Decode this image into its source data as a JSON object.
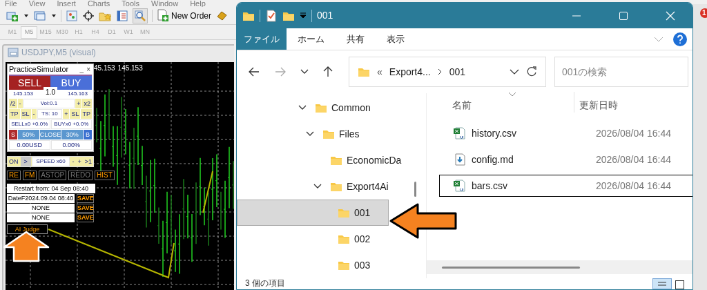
{
  "menu": [
    "File",
    "View",
    "Insert",
    "Charts",
    "Tools",
    "Window",
    "Help"
  ],
  "toolbar": {
    "new_order": "New Order"
  },
  "notification_badge": "1",
  "timeframes": [
    {
      "label": "M1",
      "selected": false
    },
    {
      "label": "M5",
      "selected": true
    },
    {
      "label": "M15",
      "selected": false
    },
    {
      "label": "M30",
      "selected": false
    },
    {
      "label": "H1",
      "selected": false
    },
    {
      "label": "H4",
      "selected": false
    },
    {
      "label": "D1",
      "selected": false
    },
    {
      "label": "W1",
      "selected": false
    },
    {
      "label": "MN",
      "selected": false
    }
  ],
  "chart_window": {
    "title": "USDJPY,M5 (visual)",
    "price_labels": [
      "45.153",
      "145.153"
    ]
  },
  "simulator": {
    "title": "PracticeSimulator",
    "minimize": "_",
    "close": "×",
    "sell": "SELL",
    "buy": "BUY",
    "bid": "145.153",
    "lot": "1.0",
    "ask": "145.163",
    "volume_row": [
      {
        "label": "/2",
        "kind": "key"
      },
      {
        "label": "-",
        "kind": "key"
      },
      {
        "label": "Vol:0.1",
        "kind": "value"
      },
      {
        "label": "+",
        "kind": "key"
      },
      {
        "label": "x2",
        "kind": "key"
      }
    ],
    "ts_row": [
      {
        "label": "TP",
        "kind": "key"
      },
      {
        "label": "SL",
        "kind": "key"
      },
      {
        "label": "-",
        "kind": "key"
      },
      {
        "label": "TS: 10",
        "kind": "value"
      },
      {
        "label": "+",
        "kind": "key"
      },
      {
        "label": "SL",
        "kind": "key"
      },
      {
        "label": "TP",
        "kind": "key"
      }
    ],
    "positions": [
      "SELLx0 +0.0%",
      "BUYx0 +0.0%"
    ],
    "close_row": [
      {
        "label": "S",
        "kind": "sell"
      },
      {
        "label": "50%",
        "kind": "part"
      },
      {
        "label": "CLOSE",
        "kind": "part"
      },
      {
        "label": "30%",
        "kind": "part"
      },
      {
        "label": "B",
        "kind": "buy"
      }
    ],
    "totals": [
      "0.00USD",
      "0.00%"
    ]
  },
  "playback": [
    {
      "label": "ON",
      "kind": "key"
    },
    {
      "label": ">",
      "kind": "play"
    },
    {
      "label": "SPEED x60",
      "kind": "value"
    },
    {
      "label": "-",
      "kind": "key"
    },
    {
      "label": "+",
      "kind": "key"
    },
    {
      "label": ">1",
      "kind": "key"
    }
  ],
  "modes": [
    {
      "label": "RE",
      "disabled": false
    },
    {
      "label": "FM",
      "disabled": false
    },
    {
      "label": "ASTOP",
      "disabled": true
    },
    {
      "label": "REDO",
      "disabled": true
    },
    {
      "label": "HIST",
      "disabled": false
    }
  ],
  "restart": "Restart from: 04 Sep 08:40",
  "saves": [
    {
      "value": "DateF2024.09.04 08:40",
      "button": "SAVE"
    },
    {
      "value": "NONE",
      "button": "SAVE"
    },
    {
      "value": "NONE",
      "button": "SAVE"
    }
  ],
  "ai_judge": "AI Judge",
  "explorer": {
    "title": "001",
    "ribbon_tabs": [
      {
        "label": "ファイル",
        "selected": true
      },
      {
        "label": "ホーム",
        "selected": false
      },
      {
        "label": "共有",
        "selected": false
      },
      {
        "label": "表示",
        "selected": false
      }
    ],
    "address": {
      "overflow": "«",
      "segments": [
        "Export4...",
        "001"
      ]
    },
    "search": {
      "placeholder": "001の検索"
    },
    "tree": [
      {
        "label": "Common",
        "expanded": true,
        "selected": false,
        "children": [
          {
            "label": "Files",
            "expanded": true,
            "selected": false,
            "children": [
              {
                "label": "EconomicDa",
                "expanded": false,
                "selected": false
              },
              {
                "label": "Export4Ai",
                "expanded": true,
                "selected": false,
                "children": [
                  {
                    "label": "001",
                    "expanded": false,
                    "selected": true
                  },
                  {
                    "label": "002",
                    "expanded": false,
                    "selected": false
                  },
                  {
                    "label": "003",
                    "expanded": false,
                    "selected": false
                  }
                ]
              }
            ]
          }
        ]
      }
    ],
    "columns": [
      "名前",
      "更新日時"
    ],
    "files": [
      {
        "name": "history.csv",
        "modified": "2026/08/04 16:44",
        "kind": "csv",
        "focused": false
      },
      {
        "name": "config.md",
        "modified": "2026/08/04 16:44",
        "kind": "md",
        "focused": false
      },
      {
        "name": "bars.csv",
        "modified": "2026/08/04 16:44",
        "kind": "csv",
        "focused": true
      }
    ],
    "status": "3 個の項目"
  }
}
